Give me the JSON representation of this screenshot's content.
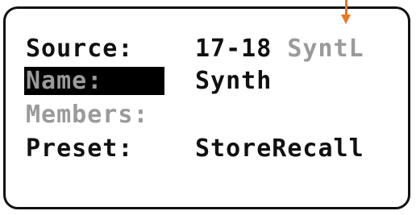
{
  "display": {
    "rows": [
      {
        "label": "Source:",
        "value": "17-18",
        "value_extra": "SyntL"
      },
      {
        "label": "Name:",
        "value": "Synth"
      },
      {
        "label": "Members:",
        "value": ""
      },
      {
        "label": "Preset:",
        "value": "StoreRecall"
      }
    ],
    "selected_row": "Name:",
    "colors": {
      "text": "#111111",
      "dim_text": "#9a9a9a",
      "highlight_bg": "#000000",
      "pointer": "#e87722"
    },
    "pointer_icon": "arrow-down-icon"
  }
}
